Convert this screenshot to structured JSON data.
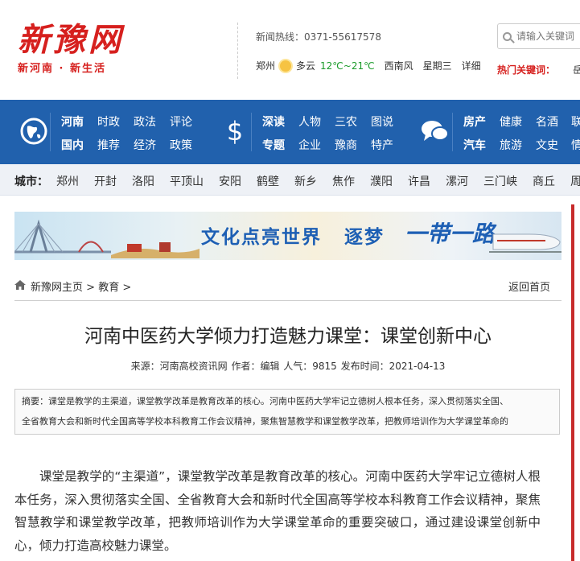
{
  "header": {
    "logo_main": "新豫网",
    "logo_sub": "新河南 · 新生活",
    "hotline": "新闻热线：0371-55617578",
    "weather": {
      "city": "郑州",
      "condition": "多云",
      "temp": "12℃~21℃",
      "wind": "西南风",
      "day": "星期三",
      "detail_link": "详细"
    },
    "search_placeholder": "请输入关键词",
    "hot_keywords_label": "热门关键词：",
    "hot_keyword_extra": "岳"
  },
  "nav": {
    "group1": [
      "河南",
      "时政",
      "政法",
      "评论",
      "国内",
      "推荐",
      "经济",
      "政策"
    ],
    "group2": [
      "深读",
      "人物",
      "三农",
      "图说",
      "专题",
      "企业",
      "豫商",
      "特产"
    ],
    "group3": [
      "房产",
      "健康",
      "名酒",
      "联",
      "汽车",
      "旅游",
      "文史",
      "情"
    ]
  },
  "citybar": {
    "label": "城市：",
    "cities": [
      "郑州",
      "开封",
      "洛阳",
      "平顶山",
      "安阳",
      "鹤壁",
      "新乡",
      "焦作",
      "濮阳",
      "许昌",
      "漯河",
      "三门峡",
      "商丘",
      "周"
    ]
  },
  "banner": {
    "text1": "文化点亮世界",
    "text2": "逐梦",
    "text3": "一带一路"
  },
  "breadcrumb": {
    "home": "新豫网主页",
    "sep": ">",
    "section": "教育",
    "back": "返回首页"
  },
  "article": {
    "title": "河南中医药大学倾力打造魅力课堂：课堂创新中心",
    "meta": "来源：河南高校资讯网 作者：编辑 人气：9815 发布时间：2021-04-13",
    "abstract_line1": "摘要：课堂是教学的主渠道，课堂教学改革是教育改革的核心。河南中医药大学牢记立德树人根本任务，深入贯彻落实全国、",
    "abstract_line2": "全省教育大会和新时代全国高等学校本科教育工作会议精神，聚焦智慧教学和课堂教学改革，把教师培训作为大学课堂革命的",
    "body": "课堂是教学的“主渠道”，课堂教学改革是教育改革的核心。河南中医药大学牢记立德树人根本任务，深入贯彻落实全国、全省教育大会和新时代全国高等学校本科教育工作会议精神，聚焦智慧教学和课堂教学改革，把教师培训作为大学课堂革命的重要突破口，通过建设课堂创新中心，倾力打造高校魅力课堂。"
  },
  "colors": {
    "brand_red": "#d6201e",
    "nav_blue": "#2161ad",
    "weather_temp_green": "#1a9b2a"
  }
}
